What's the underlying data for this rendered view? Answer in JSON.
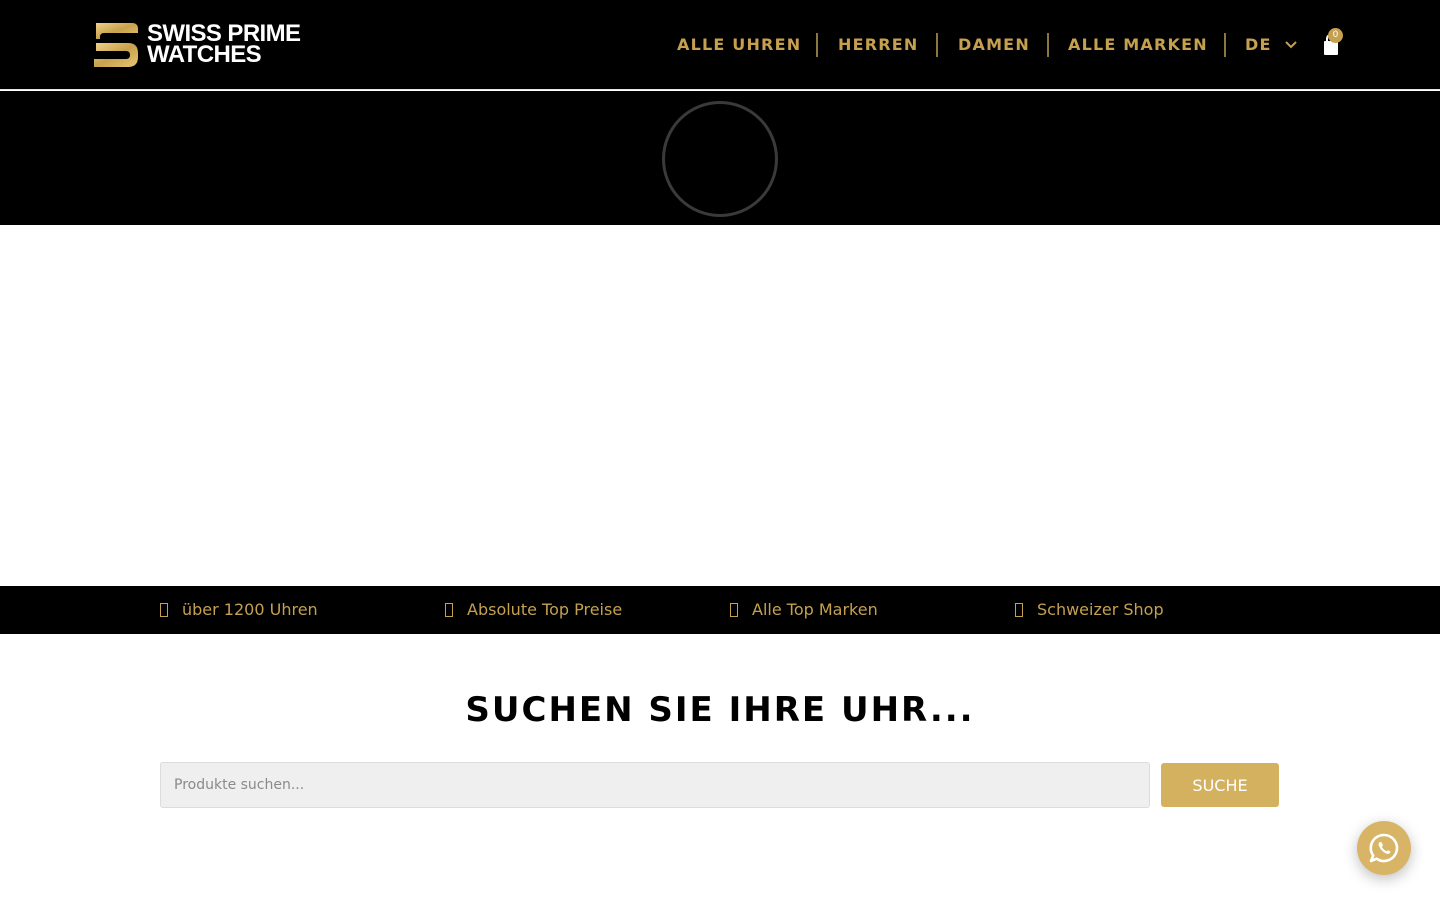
{
  "brand": {
    "line1": "SWISS PRIME",
    "line2": "WATCHES",
    "logo_icon": "sw-monogram-logo"
  },
  "nav": {
    "items": [
      {
        "label": "ALLE UHREN"
      },
      {
        "label": "HERREN"
      },
      {
        "label": "DAMEN"
      },
      {
        "label": "ALLE MARKEN"
      }
    ],
    "language": "DE",
    "language_icon": "chevron-down-icon",
    "cart_icon": "shopping-bag-icon",
    "cart_count": "0"
  },
  "hero": {
    "state_icon": "loading-spinner"
  },
  "features": [
    {
      "label": "über 1200 Uhren",
      "icon": "check-icon"
    },
    {
      "label": "Absolute Top Preise",
      "icon": "check-icon"
    },
    {
      "label": "Alle Top Marken",
      "icon": "check-icon"
    },
    {
      "label": "Schweizer Shop",
      "icon": "check-icon"
    }
  ],
  "search": {
    "title": "SUCHEN SIE IHRE UHR...",
    "placeholder": "Produkte suchen...",
    "button_label": "SUCHE"
  },
  "whatsapp": {
    "icon": "whatsapp-icon"
  },
  "colors": {
    "gold": "#c5a04f",
    "button_gold": "#d4b15f",
    "black": "#000000",
    "input_bg": "#efefef"
  }
}
